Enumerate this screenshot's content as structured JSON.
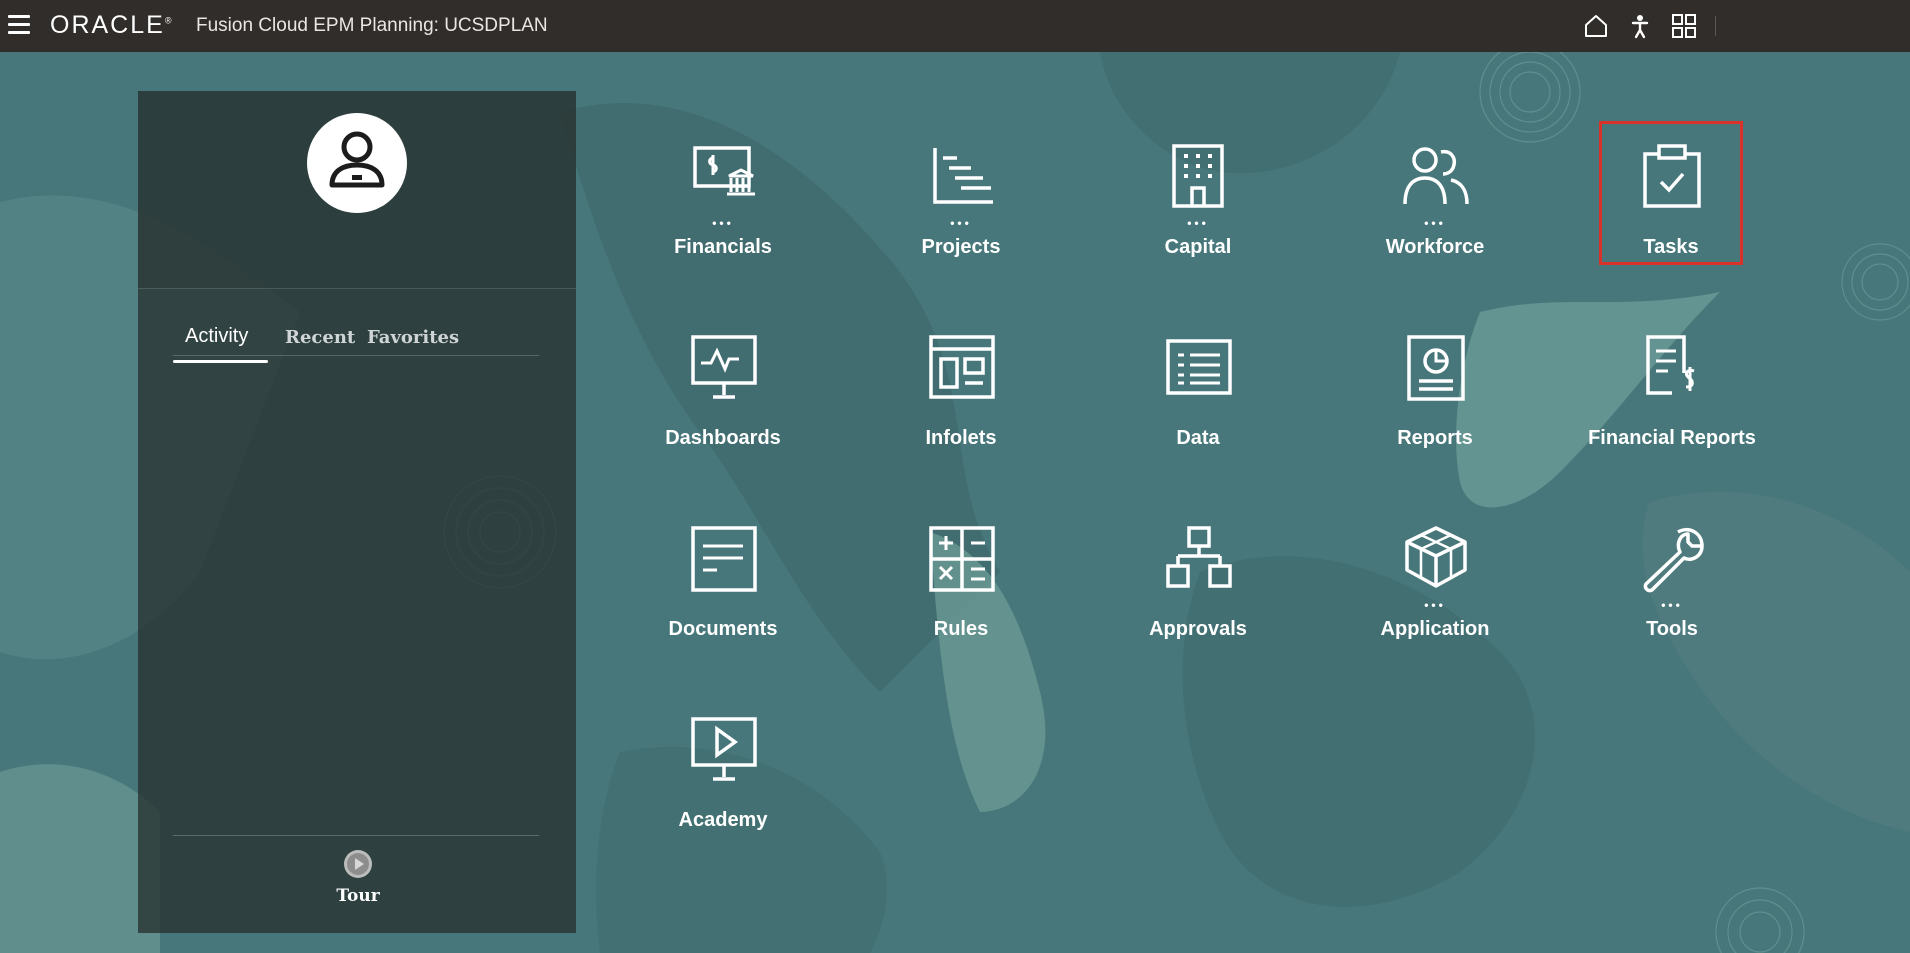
{
  "header": {
    "brand": "ORACLE",
    "brand_mark": "®",
    "app_title": "Fusion Cloud EPM Planning:  UCSDPLAN",
    "icons": [
      "home-icon",
      "accessibility-icon",
      "navigator-grid-icon"
    ]
  },
  "panel": {
    "tabs": [
      {
        "label": "Activity",
        "active": true
      },
      {
        "label": "Recent",
        "active": false
      },
      {
        "label": "Favorites",
        "active": false
      }
    ],
    "tour_label": "Tour"
  },
  "tiles": [
    {
      "label": "Financials",
      "icon": "financials-icon",
      "has_more": true
    },
    {
      "label": "Projects",
      "icon": "projects-icon",
      "has_more": true
    },
    {
      "label": "Capital",
      "icon": "capital-building-icon",
      "has_more": true
    },
    {
      "label": "Workforce",
      "icon": "workforce-people-icon",
      "has_more": true
    },
    {
      "label": "Tasks",
      "icon": "tasks-clipboard-icon",
      "has_more": false,
      "selected": true
    },
    {
      "label": "Dashboards",
      "icon": "dashboards-monitor-icon",
      "has_more": false
    },
    {
      "label": "Infolets",
      "icon": "infolets-icon",
      "has_more": false
    },
    {
      "label": "Data",
      "icon": "data-grid-icon",
      "has_more": false
    },
    {
      "label": "Reports",
      "icon": "reports-icon",
      "has_more": false
    },
    {
      "label": "Financial Reports",
      "icon": "financial-reports-icon",
      "has_more": false
    },
    {
      "label": "Documents",
      "icon": "documents-icon",
      "has_more": false
    },
    {
      "label": "Rules",
      "icon": "rules-calculator-icon",
      "has_more": false
    },
    {
      "label": "Approvals",
      "icon": "approvals-hierarchy-icon",
      "has_more": false
    },
    {
      "label": "Application",
      "icon": "application-cube-icon",
      "has_more": true
    },
    {
      "label": "Tools",
      "icon": "tools-wrench-icon",
      "has_more": true
    },
    {
      "label": "Academy",
      "icon": "academy-play-icon",
      "has_more": false
    }
  ],
  "more_indicator": "•••",
  "colors": {
    "header_bg": "#312d2a",
    "page_bg": "#47777a",
    "selection_outline": "#d9322b"
  }
}
